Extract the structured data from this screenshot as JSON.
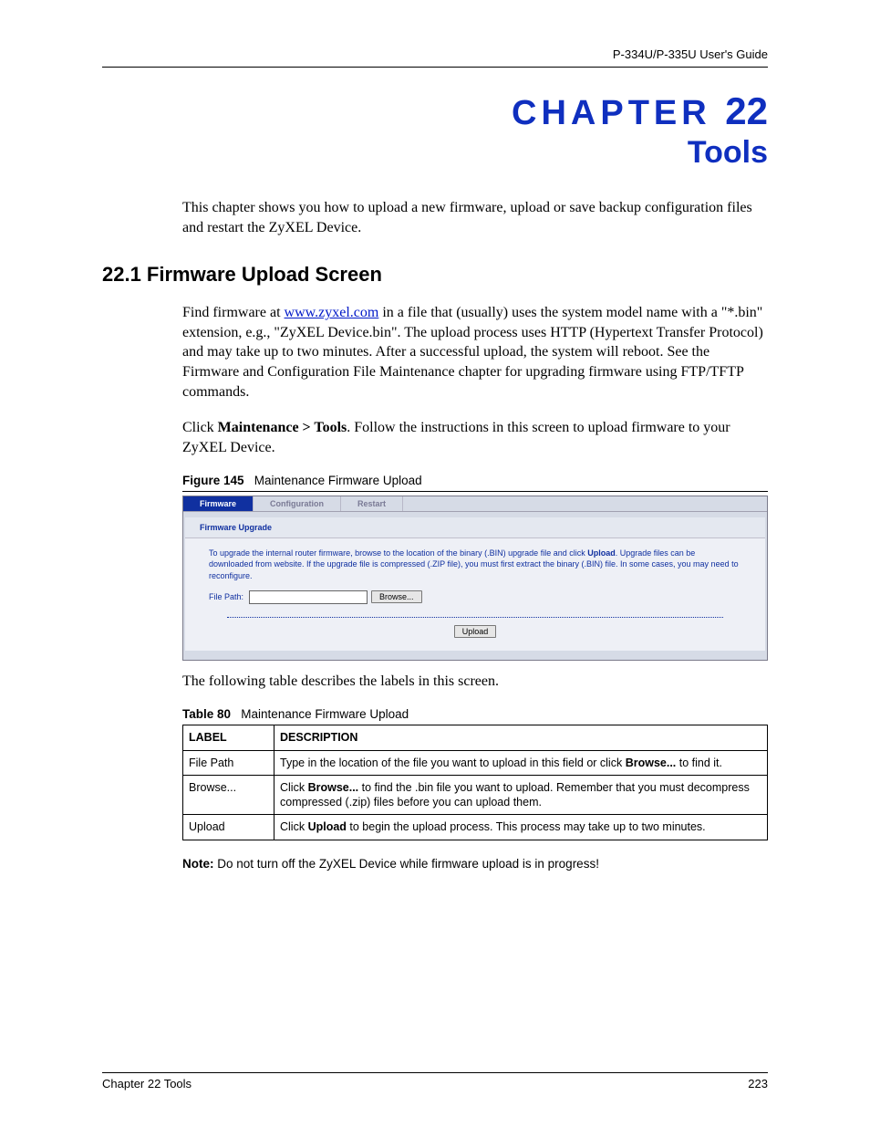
{
  "header": {
    "doc_title": "P-334U/P-335U User's Guide"
  },
  "chapter": {
    "label": "CHAPTER",
    "number": "22",
    "title": "Tools",
    "intro": "This chapter shows you how to upload a new firmware, upload or save backup configuration files and restart the ZyXEL Device."
  },
  "section": {
    "heading": "22.1  Firmware Upload Screen",
    "p1_pre": "Find firmware at ",
    "p1_link": "www.zyxel.com",
    "p1_post": " in a file that (usually) uses the system model name with a \"*.bin\" extension, e.g., \"ZyXEL Device.bin\". The upload process uses HTTP (Hypertext Transfer Protocol) and may take up to two minutes. After a successful upload, the system will reboot.  See the Firmware and Configuration File Maintenance chapter for upgrading firmware using FTP/TFTP commands.",
    "p2_pre": "Click ",
    "p2_bold": "Maintenance > Tools",
    "p2_post": ". Follow the instructions in this screen to upload firmware to your ZyXEL Device."
  },
  "figure": {
    "label": "Figure 145",
    "caption": "Maintenance Firmware Upload",
    "tabs": {
      "firmware": "Firmware",
      "configuration": "Configuration",
      "restart": "Restart"
    },
    "panel_title": "Firmware Upgrade",
    "panel_text_pre": "To upgrade the internal router firmware, browse to the location of the binary (.BIN) upgrade file and click ",
    "panel_text_bold": "Upload",
    "panel_text_post": ". Upgrade files can be downloaded from website. If the upgrade file is compressed (.ZIP file), you must first extract the binary (.BIN) file. In some cases, you may need to reconfigure.",
    "file_label": "File Path:",
    "browse_btn": "Browse...",
    "upload_btn": "Upload"
  },
  "after_figure": "The following table describes the labels in this screen.",
  "table": {
    "label": "Table 80",
    "caption": "Maintenance Firmware Upload",
    "head_label": "LABEL",
    "head_desc": "DESCRIPTION",
    "rows": [
      {
        "label": "File Path",
        "desc_pre": "Type in the location of the file you want to upload in this field or click ",
        "desc_bold": "Browse...",
        "desc_post": " to find it."
      },
      {
        "label": "Browse...",
        "desc_pre": "Click ",
        "desc_bold": "Browse...",
        "desc_post": " to find the .bin file you want to upload. Remember that you must decompress compressed (.zip) files before you can upload them."
      },
      {
        "label": "Upload",
        "desc_pre": "Click ",
        "desc_bold": "Upload",
        "desc_post": " to begin the upload process. This process may take up to two minutes."
      }
    ]
  },
  "note": {
    "bold": "Note:",
    "text": " Do not turn off the ZyXEL Device while firmware upload is in progress!"
  },
  "footer": {
    "left": "Chapter 22 Tools",
    "right": "223"
  }
}
